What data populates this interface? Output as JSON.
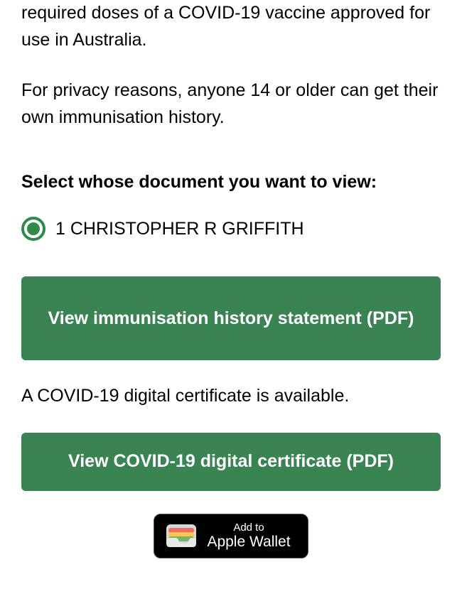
{
  "intro": {
    "p1": "required doses of a COVID-19 vaccine approved for use in Australia.",
    "p2": "For privacy reasons, anyone 14 or older can get their own immunisation history."
  },
  "select_heading": "Select whose document you want to view:",
  "person_option": "1 CHRISTOPHER R GRIFFITH",
  "btn_history": "View immunisation history statement (PDF)",
  "cert_available_text": "A COVID-19 digital certificate is available.",
  "btn_certificate": "View COVID-19 digital certificate (PDF)",
  "wallet": {
    "add_to": "Add to",
    "apple_wallet": "Apple Wallet"
  }
}
